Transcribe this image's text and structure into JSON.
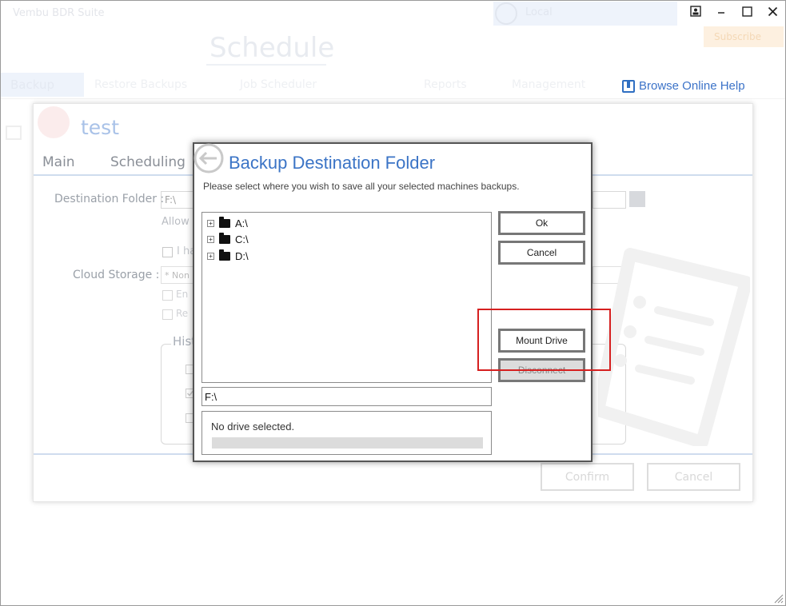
{
  "window": {
    "app_title": "Vembu BDR Suite",
    "user_name": "Local",
    "orange_button": "Subscribe",
    "controls": [
      "minimize",
      "maximize",
      "close"
    ]
  },
  "page": {
    "heading": "Schedule",
    "nav": {
      "active": "Backup",
      "items": [
        "Backup",
        "Restore Backups",
        "Job Scheduler",
        "Reports",
        "Management"
      ]
    },
    "help_link": "Browse Online Help"
  },
  "job_dialog": {
    "title": "test",
    "tabs": [
      "Main",
      "Scheduling"
    ],
    "destination_label": "Destination Folder :",
    "destination_value": "F:\\",
    "allow_text": "Allow",
    "have_text": "I ha",
    "cloud_label": "Cloud Storage :",
    "cloud_value": "* Non",
    "enable_text": "En",
    "re_text": "Re",
    "history_label": "Hist",
    "confirm_label": "Confirm",
    "cancel_label": "Cancel"
  },
  "modal": {
    "title": "Backup Destination Folder",
    "subtitle": "Please select where you wish to save all your selected machines backups.",
    "tree": [
      {
        "label": "A:\\",
        "expander": "+"
      },
      {
        "label": "C:\\",
        "expander": "+"
      },
      {
        "label": "D:\\",
        "expander": "+"
      }
    ],
    "path_value": "F:\\",
    "status_text": "No drive selected.",
    "progress": 0,
    "buttons": {
      "ok": "Ok",
      "cancel": "Cancel",
      "mount": "Mount Drive",
      "disconnect": "Disconnect"
    }
  },
  "colors": {
    "accent": "#3b74c6",
    "highlight": "#d62020"
  }
}
